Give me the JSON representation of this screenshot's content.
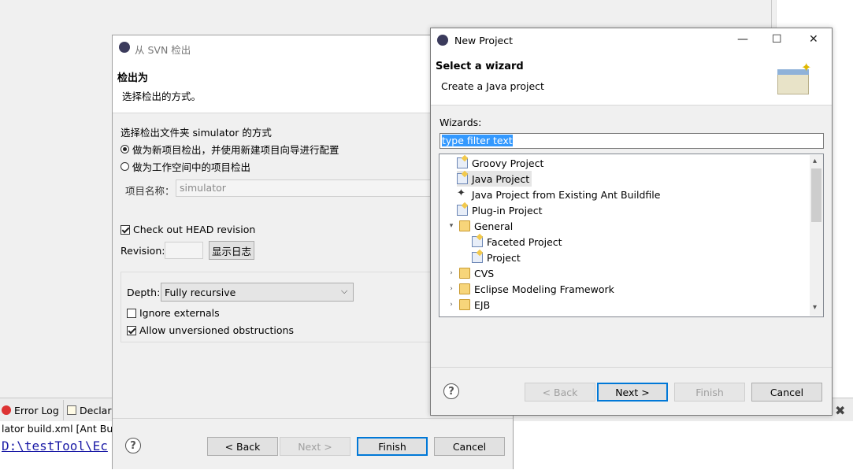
{
  "svn_dialog": {
    "title": "从 SVN 检出",
    "header_title": "检出为",
    "header_desc": "选择检出的方式。",
    "group_label": "选择检出文件夹 simulator 的方式",
    "option_new_project": "做为新项目检出，并使用新建项目向导进行配置",
    "option_workspace_project": "做为工作空间中的项目检出",
    "project_name_label": "项目名称：",
    "project_name_value": "simulator",
    "checkout_head_label": "Check out HEAD revision",
    "revision_label": "Revision:",
    "revision_value": "",
    "show_log_label": "显示日志",
    "depth_label": "Depth:",
    "depth_value": "Fully recursive",
    "ignore_externals_label": "Ignore externals",
    "allow_unversioned_label": "Allow unversioned obstructions",
    "back_label": "< Back",
    "next_label": "Next >",
    "finish_label": "Finish",
    "cancel_label": "Cancel",
    "help_glyph": "?"
  },
  "new_project_dialog": {
    "title": "New Project",
    "header_title": "Select a wizard",
    "header_desc": "Create a Java project",
    "wizards_label": "Wizards:",
    "filter_value": "type filter text",
    "tree_items": [
      {
        "label": "Groovy Project"
      },
      {
        "label": "Java Project"
      },
      {
        "label": "Java Project from Existing Ant Buildfile"
      },
      {
        "label": "Plug-in Project"
      },
      {
        "label": "General"
      },
      {
        "label": "Faceted Project"
      },
      {
        "label": "Project"
      },
      {
        "label": "CVS"
      },
      {
        "label": "Eclipse Modeling Framework"
      },
      {
        "label": "EJB"
      }
    ],
    "back_label": "< Back",
    "next_label": "Next >",
    "finish_label": "Finish",
    "cancel_label": "Cancel",
    "help_glyph": "?",
    "minimize_glyph": "—",
    "maximize_glyph": "☐",
    "close_glyph": "✕"
  },
  "workbench": {
    "error_log_tab": "Error Log",
    "declaration_tab": "Declar",
    "console_title": "lator build.xml [Ant Build",
    "console_line": "D:\\testTool\\Ec",
    "close_glyph": "✖"
  },
  "colors": {
    "accent": "#0078d7",
    "selection": "#3399ff"
  }
}
